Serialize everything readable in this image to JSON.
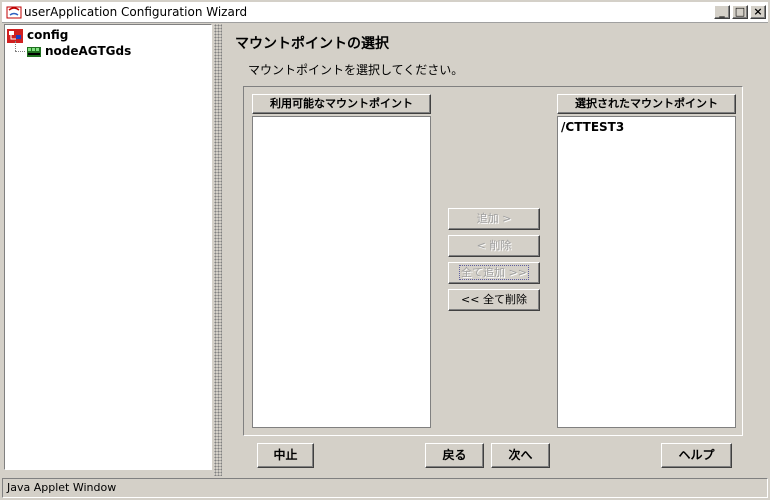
{
  "window": {
    "title": "userApplication Configuration Wizard",
    "min_glyph": "_",
    "max_glyph": "□",
    "close_glyph": "×"
  },
  "tree": {
    "root_label": "config",
    "child_label": "nodeAGTGds"
  },
  "page": {
    "title": "マウントポイントの選択",
    "instruction": "マウントポイントを選択してください。"
  },
  "available": {
    "header": "利用可能なマウントポイント",
    "items": []
  },
  "selected": {
    "header": "選択されたマウントポイント",
    "items": [
      "/CTTEST3"
    ]
  },
  "transfer_buttons": {
    "add": "追加 >",
    "remove": "< 削除",
    "add_all": "全て追加 >>",
    "remove_all": "<< 全て削除"
  },
  "nav_buttons": {
    "cancel": "中止",
    "back": "戻る",
    "next": "次へ",
    "help": "ヘルプ"
  },
  "status_bar": {
    "text": "Java Applet Window"
  },
  "icons": {
    "app": "java-applet-icon",
    "root": "config-folder-icon",
    "child": "node-icon"
  }
}
